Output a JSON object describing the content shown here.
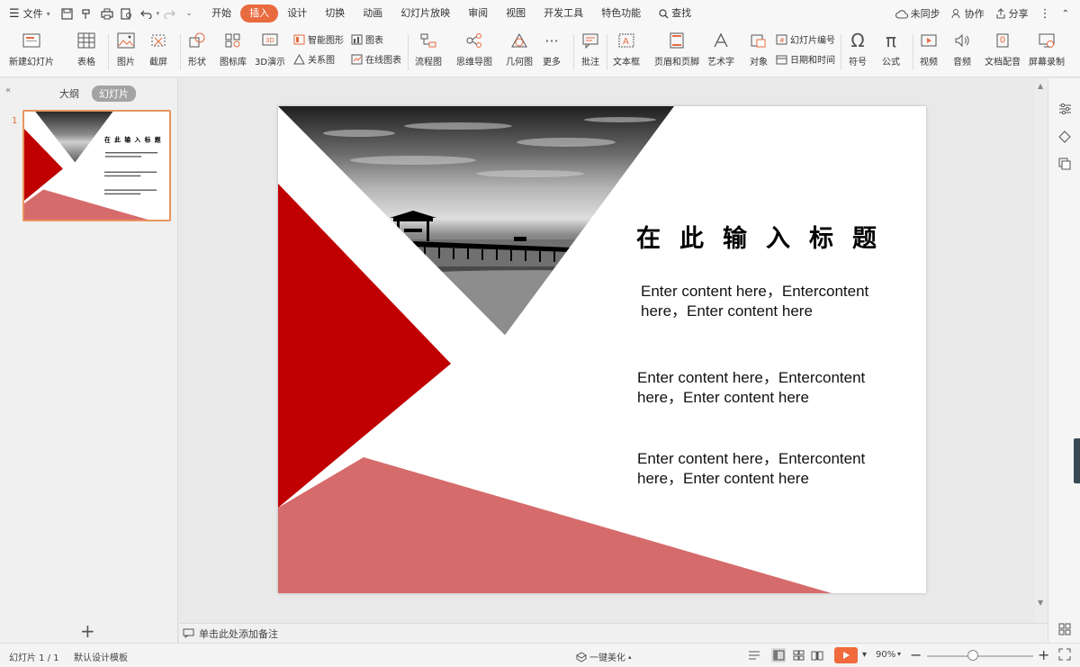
{
  "menubar": {
    "file_label": "文件",
    "tabs": [
      "开始",
      "插入",
      "设计",
      "切换",
      "动画",
      "幻灯片放映",
      "审阅",
      "视图",
      "开发工具",
      "特色功能"
    ],
    "active_tab": "插入",
    "search_label": "查找",
    "right": {
      "sync": "未同步",
      "collab": "协作",
      "share": "分享"
    }
  },
  "ribbon": {
    "new_slide": "新建幻灯片",
    "table": "表格",
    "picture": "图片",
    "screenshot": "截屏",
    "shape": "形状",
    "icon_lib": "图标库",
    "demo3d": "3D演示",
    "smart_graphic": "智能图形",
    "chart": "图表",
    "relation": "关系图",
    "online_chart": "在线图表",
    "flowchart": "流程图",
    "mindmap": "思维导图",
    "geometry": "几何图",
    "more": "更多",
    "comment": "批注",
    "textbox": "文本框",
    "header_footer": "页眉和页脚",
    "wordart": "艺术字",
    "object": "对象",
    "slide_number": "幻灯片编号",
    "datetime": "日期和时间",
    "symbol": "符号",
    "formula": "公式",
    "video": "视频",
    "audio": "音频",
    "doc_dub": "文档配音",
    "screen_record": "屏幕录制"
  },
  "leftpanel": {
    "tab_outline": "大纲",
    "tab_slides": "幻灯片",
    "slide_number": "1"
  },
  "slide": {
    "title": "在此输入标题",
    "body1": "Enter content here，Entercontent here，Enter content here",
    "body2": "Enter content here，Entercontent here，Enter content here",
    "body3": "Enter content here，Entercontent here，Enter content here"
  },
  "notes": {
    "placeholder": "单击此处添加备注"
  },
  "statusbar": {
    "slide_info": "幻灯片 1 / 1",
    "template": "默认设计模板",
    "beautify": "一键美化",
    "zoom": "90%"
  },
  "colors": {
    "accent": "#e86a3f",
    "slide_red": "#c00000",
    "slide_pink": "#d66b6b"
  }
}
